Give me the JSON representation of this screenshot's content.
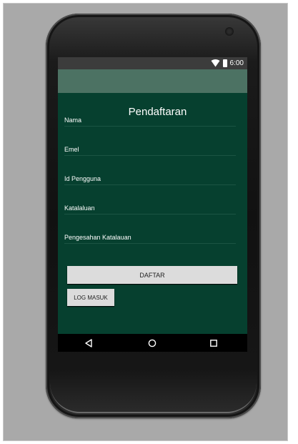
{
  "status_bar": {
    "time": "6:00",
    "icons": [
      "wifi-icon",
      "battery-icon"
    ]
  },
  "form": {
    "title": "Pendaftaran",
    "fields": [
      {
        "label": "Nama"
      },
      {
        "label": "Emel"
      },
      {
        "label": "Id Pengguna"
      },
      {
        "label": "Katalaluan"
      },
      {
        "label": "Pengesahan Katalauan"
      }
    ],
    "register_button": "DAFTAR",
    "login_button": "LOG MASUK"
  },
  "nav_bar": {
    "buttons": [
      "back-icon",
      "home-icon",
      "recents-icon"
    ]
  },
  "colors": {
    "screen_bg": "#06402f",
    "app_bar": "#4c7263",
    "status_bar": "#3c3c3c",
    "button_bg": "#dcdcdc"
  }
}
